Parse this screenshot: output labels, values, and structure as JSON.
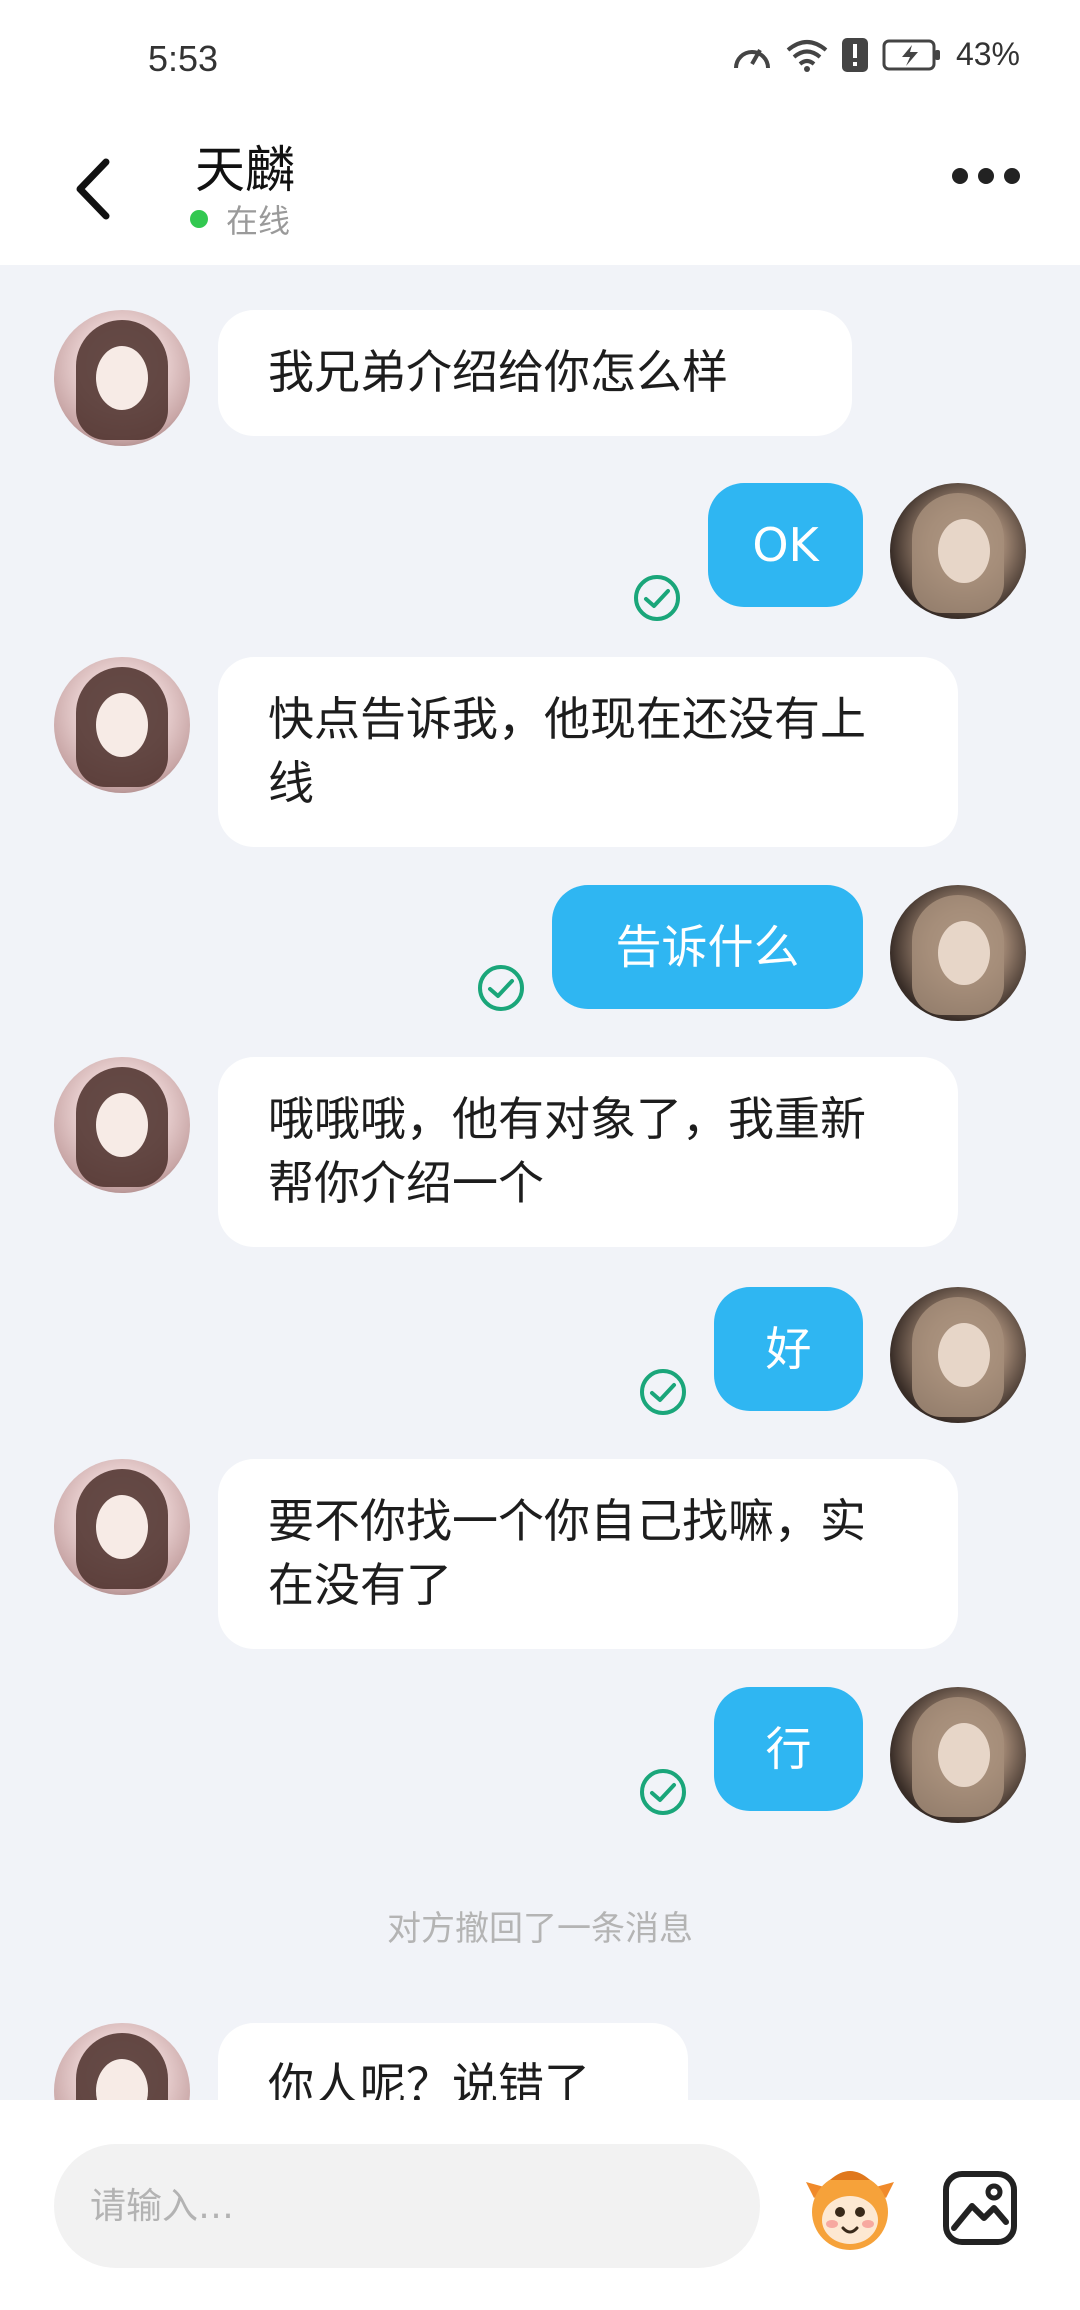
{
  "status_bar": {
    "time": "5:53",
    "battery": "43"
  },
  "header": {
    "contact_name": "天麟",
    "presence": "在线"
  },
  "messages": [
    {
      "from": "them",
      "text": "我兄弟介绍给你怎么样"
    },
    {
      "from": "me",
      "text": "OK",
      "status": "read"
    },
    {
      "from": "them",
      "text": "快点告诉我，他现在还没有上线"
    },
    {
      "from": "me",
      "text": "告诉什么",
      "status": "read"
    },
    {
      "from": "them",
      "text": "哦哦哦，他有对象了，我重新帮你介绍一个"
    },
    {
      "from": "me",
      "text": "好",
      "status": "read"
    },
    {
      "from": "them",
      "text": "要不你找一个你自己找嘛，实在没有了"
    },
    {
      "from": "me",
      "text": "行",
      "status": "read"
    },
    {
      "from": "them",
      "text": "你人呢？说错了"
    }
  ],
  "system_notice": "对方撤回了一条消息",
  "input": {
    "placeholder": "请输入…"
  },
  "colors": {
    "accent": "#2fb6f2",
    "online": "#32c850",
    "read_check": "#1aa67a"
  }
}
